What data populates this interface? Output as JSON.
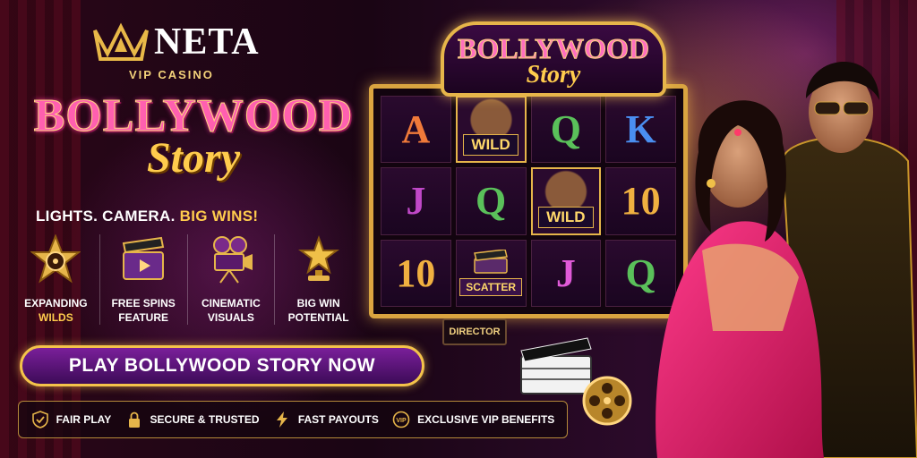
{
  "brand": {
    "name": "NETA",
    "subtitle": "VIP CASINO"
  },
  "title": {
    "line1": "BOLLYWOOD",
    "line2": "Story"
  },
  "tagline": {
    "plain": "LIGHTS. CAMERA. ",
    "highlight": "BIG WINS!"
  },
  "features": [
    {
      "icon": "film-reel-star-icon",
      "line1": "EXPANDING",
      "line2": "WILDS"
    },
    {
      "icon": "clapperboard-icon",
      "line1": "FREE SPINS",
      "line2": "FEATURE"
    },
    {
      "icon": "film-camera-icon",
      "line1": "CINEMATIC",
      "line2": "VISUALS"
    },
    {
      "icon": "star-trophy-icon",
      "line1": "BIG WIN",
      "line2": "POTENTIAL"
    }
  ],
  "cta": {
    "label": "PLAY BOLLYWOOD STORY NOW"
  },
  "trust": [
    {
      "icon": "shield-check-icon",
      "label": "FAIR PLAY"
    },
    {
      "icon": "lock-icon",
      "label": "SECURE & TRUSTED"
    },
    {
      "icon": "lightning-icon",
      "label": "FAST PAYOUTS"
    },
    {
      "icon": "vip-badge-icon",
      "label": "EXCLUSIVE VIP BENEFITS"
    }
  ],
  "slot": {
    "marquee_line1": "BOLLYWOOD",
    "marquee_line2": "Story",
    "reels": [
      [
        "A",
        "WILD",
        "Q",
        "K"
      ],
      [
        "J",
        "Q",
        "WILD",
        "10"
      ],
      [
        "10",
        "SCATTER",
        "J",
        "Q"
      ]
    ],
    "wild_label": "WILD",
    "scatter_label": "SCATTER"
  },
  "props": {
    "director_chair": "DIRECTOR"
  },
  "colors": {
    "accent_gold": "#f4c34a",
    "cta_purple": "#7a1f9a",
    "title_pink": "#ff5fb0"
  }
}
